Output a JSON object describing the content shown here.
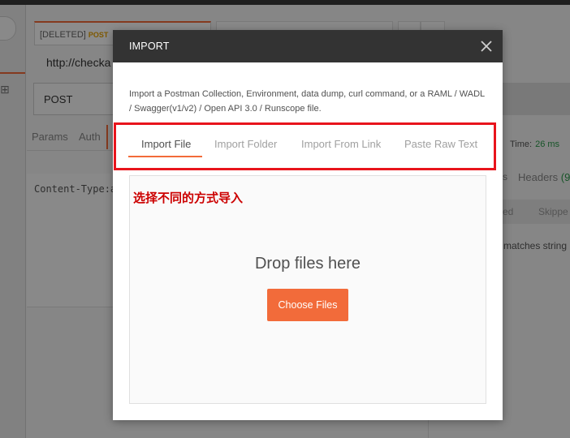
{
  "background": {
    "tab_label": "[DELETED]",
    "tab_method": "POST",
    "url": "http://checka",
    "method": "POST",
    "params_tab": "Params",
    "auth_tab": "Auth",
    "body_code": "Content-Type:a",
    "time_label": "Time:",
    "time_value": "26 ms",
    "s_tab": "s",
    "headers_tab": "Headers",
    "headers_count": "(9",
    "row_a": "ed",
    "row_b": "Skippe",
    "matches": "matches string"
  },
  "modal": {
    "title": "IMPORT",
    "description": "Import a Postman Collection, Environment, data dump, curl command, or a RAML / WADL / Swagger(v1/v2) / Open API 3.0 / Runscope file.",
    "tabs": [
      {
        "label": "Import File",
        "active": true
      },
      {
        "label": "Import Folder",
        "active": false
      },
      {
        "label": "Import From Link",
        "active": false
      },
      {
        "label": "Paste Raw Text",
        "active": false
      }
    ],
    "annotation": "选择不同的方式导入",
    "drop_text": "Drop files here",
    "choose_button": "Choose Files"
  },
  "colors": {
    "accent": "#f26b3a",
    "header": "#333333",
    "highlight": "#e8141c",
    "annotation": "#cc0000"
  }
}
